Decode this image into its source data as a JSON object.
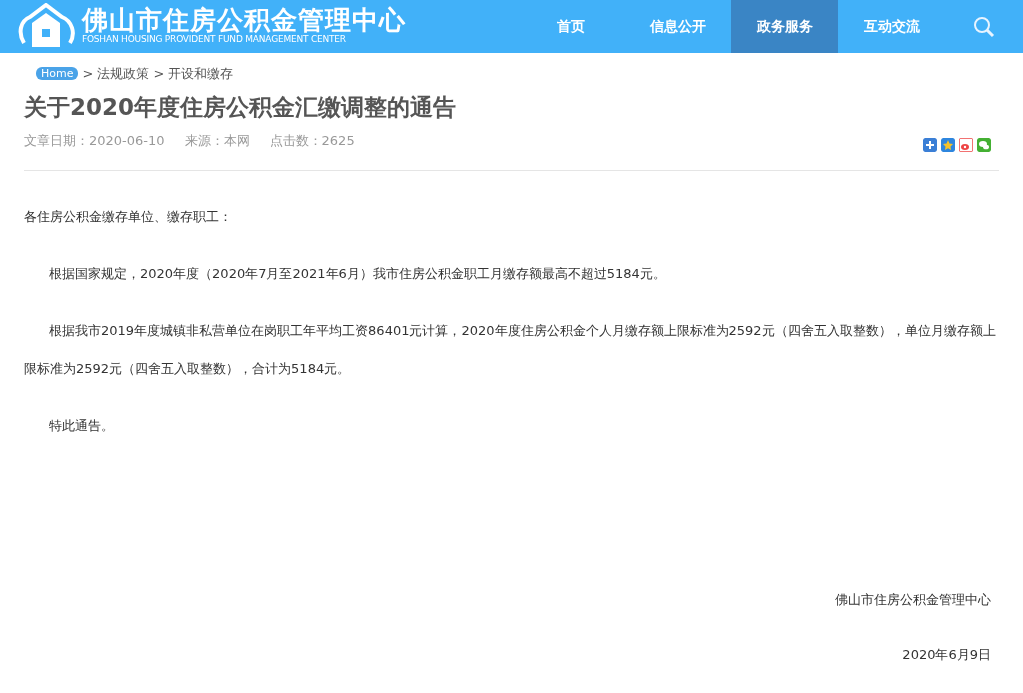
{
  "header": {
    "title": "佛山市住房公积金管理中心",
    "subtitle": "FOSHAN HOUSING PROVIDENT FUND MANAGEMENT CENTER"
  },
  "nav": [
    {
      "label": "首页",
      "selected": false
    },
    {
      "label": "信息公开",
      "selected": false
    },
    {
      "label": "政务服务",
      "selected": true
    },
    {
      "label": "互动交流",
      "selected": false
    }
  ],
  "breadcrumb": [
    {
      "kind": "home",
      "text": "Home"
    },
    {
      "kind": "sep",
      "text": ">"
    },
    {
      "kind": "link",
      "text": "法规政策"
    },
    {
      "kind": "sep",
      "text": ">"
    },
    {
      "kind": "link",
      "text": "开设和缴存"
    }
  ],
  "article": {
    "title": "关于2020年度住房公积金汇缴调整的通告",
    "meta": [
      "文章日期：2020-06-10",
      "来源：本网",
      "点击数：2625"
    ],
    "paragraphs": [
      {
        "kind": "plain",
        "text": "各住房公积金缴存单位、缴存职工："
      },
      {
        "kind": "indent",
        "text": "根据国家规定，2020年度（2020年7月至2021年6月）我市住房公积金职工月缴存额最高不超过5184元。"
      },
      {
        "kind": "indent",
        "text": "根据我市2019年度城镇非私营单位在岗职工年平均工资86401元计算，2020年度住房公积金个人月缴存额上限标准为2592元（四舍五入取整数），单位月缴存额上限标准为2592元（四舍五入取整数），合计为5184元。"
      },
      {
        "kind": "indent",
        "text": "特此通告。"
      }
    ],
    "signature": "佛山市住房公积金管理中心",
    "date": "2020年6月9日"
  }
}
